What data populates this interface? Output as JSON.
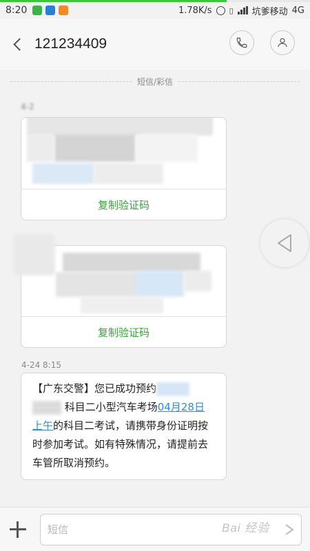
{
  "status_bar": {
    "time": "8:20",
    "net_speed": "1.78K/s",
    "carrier": "坑爹移动",
    "network": "4G",
    "load_progress": 0.73
  },
  "header": {
    "title": "121234409",
    "call_icon": "phone-icon",
    "contact_icon": "person-icon"
  },
  "thread": {
    "divider_label": "短信/彩信",
    "messages": [
      {
        "time": "4-2",
        "blurred": true,
        "action_label": "复制验证码"
      },
      {
        "time": "",
        "blurred": true,
        "action_label": "复制验证码"
      },
      {
        "time": "4-24 8:15",
        "blurred": false,
        "text_1": "【广东交警】您已成功预约",
        "text_2": "科目二小型汽车考场",
        "link_text_1": "04月28日",
        "link_text_2": "上午",
        "text_3": "的科目二考试，请携带身份证明按时参加考试。如有特殊情况，请提前去车管所取消预约。"
      }
    ]
  },
  "side_panel": {
    "arrow_icon": "triangle-left-icon"
  },
  "composer": {
    "add_icon": "plus-icon",
    "input_placeholder": "短信",
    "send_icon": "send-icon"
  },
  "watermark": "Bai 经验",
  "colors": {
    "accent_green": "#3aa23a",
    "link_blue": "#2e8ce6",
    "background": "#f2f2f2"
  }
}
